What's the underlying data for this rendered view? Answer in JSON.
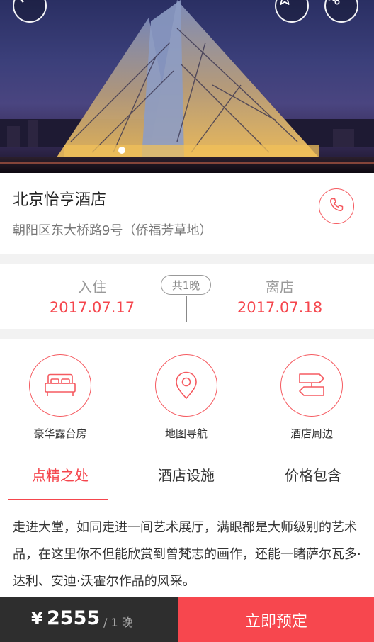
{
  "hotel": {
    "name": "北京怡亨酒店",
    "address": "朝阳区东大桥路9号（侨福芳草地）"
  },
  "stay": {
    "checkin_label": "入住",
    "checkin_date": "2017.07.17",
    "nights": "共1晚",
    "checkout_label": "离店",
    "checkout_date": "2017.07.18"
  },
  "features": [
    {
      "label": "豪华露台房",
      "icon": "bed-icon"
    },
    {
      "label": "地图导航",
      "icon": "map-pin-icon"
    },
    {
      "label": "酒店周边",
      "icon": "signpost-icon"
    }
  ],
  "tabs": [
    {
      "label": "点精之处",
      "active": true
    },
    {
      "label": "酒店设施",
      "active": false
    },
    {
      "label": "价格包含",
      "active": false
    }
  ],
  "description": "走进大堂，如同走进一间艺术展厅，满眼都是大师级别的艺术品，在这里你不但能欣赏到曾梵志的画作，还能一睹萨尔瓦多·达利、安迪·沃霍尔作品的风采。",
  "booking": {
    "currency": "¥",
    "price": "2555",
    "unit": "/ 1 晚",
    "book_label": "立即预定"
  },
  "colors": {
    "accent": "#f5464d",
    "bar_dark": "#2e2e2e"
  }
}
